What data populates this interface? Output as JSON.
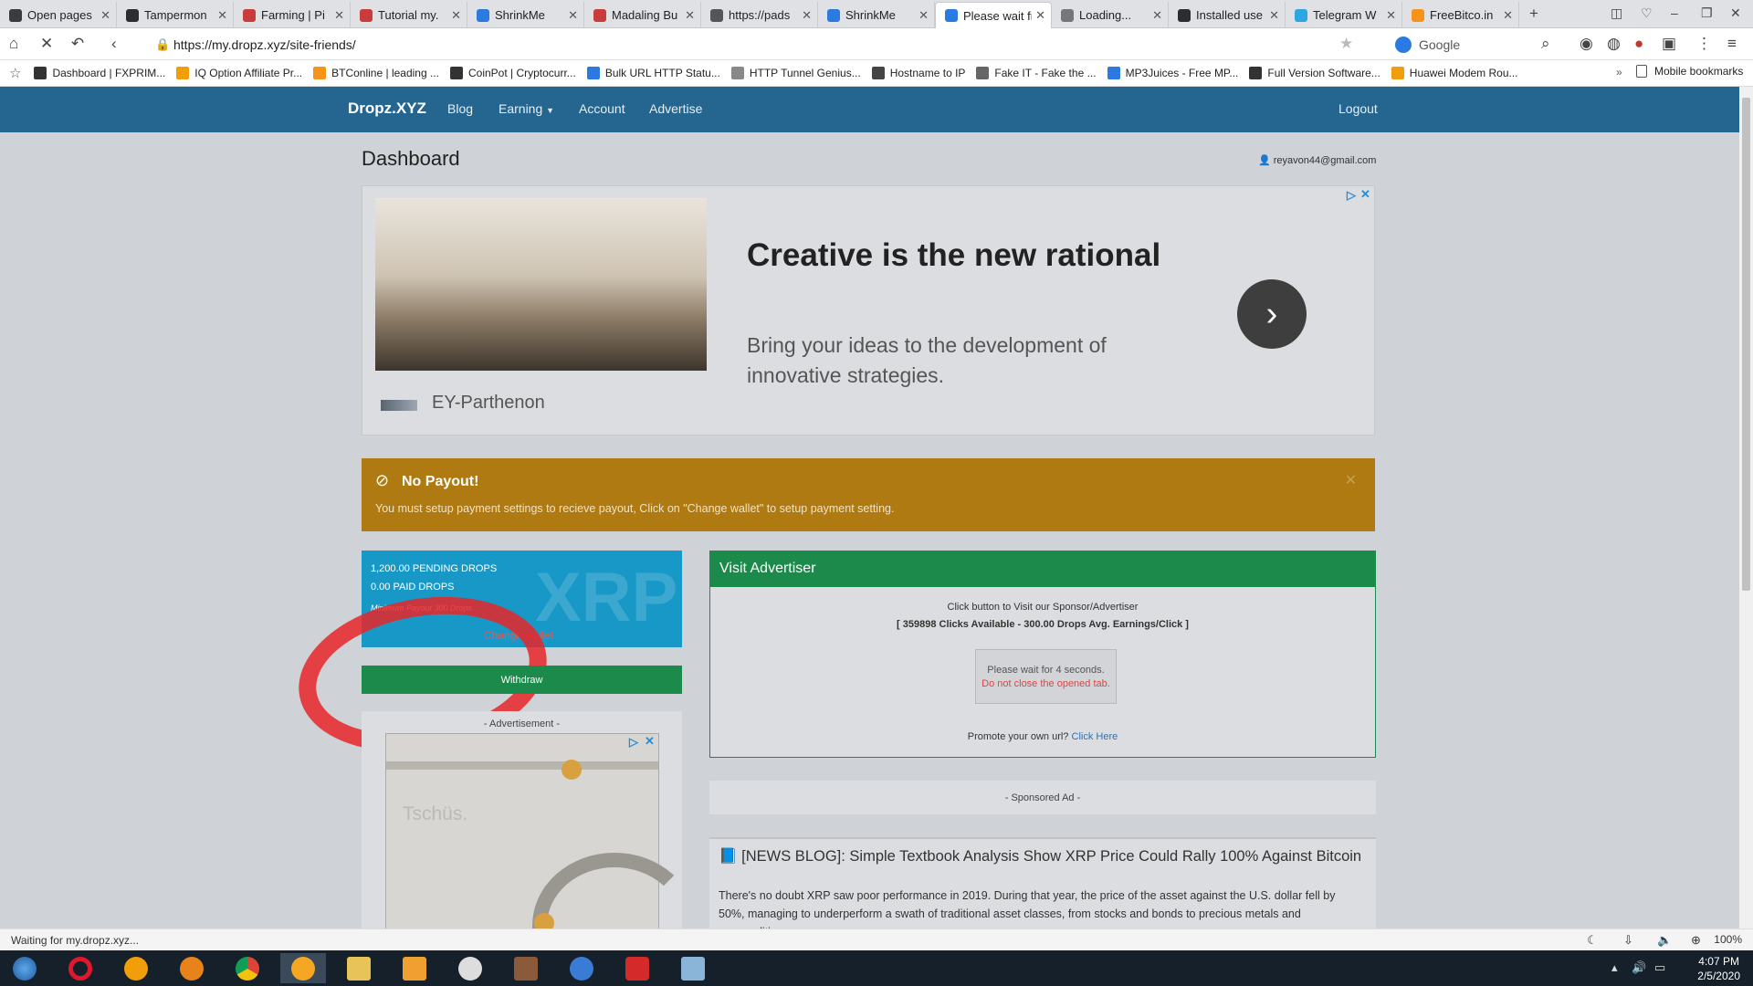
{
  "tabs": [
    {
      "label": "Open pages",
      "icon": "page-icon",
      "color": "#3b3b3b"
    },
    {
      "label": "Tampermon",
      "icon": "tampermonkey-icon",
      "color": "#2d2d2d"
    },
    {
      "label": "Farming | Pi",
      "icon": "shield-icon",
      "color": "#c83c3c"
    },
    {
      "label": "Tutorial my.",
      "icon": "shield-icon",
      "color": "#c83c3c"
    },
    {
      "label": "ShrinkMe",
      "icon": "loading-icon",
      "color": "#2a7ae2"
    },
    {
      "label": "Madaling Bu",
      "icon": "shield-icon",
      "color": "#c83c3c"
    },
    {
      "label": "https://pads",
      "icon": "page-icon",
      "color": "#555555"
    },
    {
      "label": "ShrinkMe",
      "icon": "loading-icon",
      "color": "#2a7ae2"
    },
    {
      "label": "Please wait fr",
      "icon": "loading-icon",
      "color": "#2a7ae2"
    },
    {
      "label": "Loading...",
      "icon": "loading-icon",
      "color": "#777777"
    },
    {
      "label": "Installed use",
      "icon": "tampermonkey-icon",
      "color": "#2d2d2d"
    },
    {
      "label": "Telegram W",
      "icon": "telegram-icon",
      "color": "#2ca5e0"
    },
    {
      "label": "FreeBitco.in",
      "icon": "bitcoin-icon",
      "color": "#f7931a"
    }
  ],
  "address": {
    "url": "https://my.dropz.xyz/site-friends/",
    "search_engine": "Google"
  },
  "bookmarks": [
    {
      "label": "Dashboard | FXPRIM...",
      "color": "#333333"
    },
    {
      "label": "IQ Option Affiliate Pr...",
      "color": "#f29d0a"
    },
    {
      "label": "BTConline | leading ...",
      "color": "#f7931a"
    },
    {
      "label": "CoinPot | Cryptocurr...",
      "color": "#333333"
    },
    {
      "label": "Bulk URL HTTP Statu...",
      "color": "#2a7ae2"
    },
    {
      "label": "HTTP Tunnel Genius...",
      "color": "#888888"
    },
    {
      "label": "Hostname to IP",
      "color": "#444444"
    },
    {
      "label": "Fake IT - Fake the ...",
      "color": "#666666"
    },
    {
      "label": "MP3Juices - Free MP...",
      "color": "#2a7ae2"
    },
    {
      "label": "Full Version Software...",
      "color": "#333333"
    },
    {
      "label": "Huawei Modem Rou...",
      "color": "#f29d0a"
    }
  ],
  "bookmarks_overflow": "Mobile bookmarks",
  "site": {
    "brand": "Dropz.XYZ",
    "nav": [
      "Blog",
      "Earning",
      "Account",
      "Advertise"
    ],
    "logout": "Logout",
    "page_title": "Dashboard",
    "user_email": "reyavon44@gmail.com"
  },
  "ad_top": {
    "headline": "Creative is the new rational",
    "body": "Bring your ideas to the development of innovative strategies.",
    "brand": "EY-Parthenon"
  },
  "alert": {
    "title": "No Payout!",
    "message": "You must setup payment settings to recieve payout, Click on \"Change wallet\" to setup payment setting.",
    "color": "#b07a12"
  },
  "wallet": {
    "pending": "1,200.00 PENDING DROPS",
    "paid": "0.00 PAID DROPS",
    "minimum": "Minimum Payout 300 Drops",
    "change_wallet": "Change wallet",
    "watermark": "XRP",
    "withdraw": "Withdraw"
  },
  "ad_side": {
    "label": "- Advertisement -",
    "text": "Tschüs."
  },
  "visit": {
    "title": "Visit Advertiser",
    "subtitle": "Click button to Visit our Sponsor/Advertiser",
    "stats": "[ 359898 Clicks Available - 300.00 Drops Avg. Earnings/Click ]",
    "wait": "Please wait for 4 seconds.",
    "warning": "Do not close the opened tab.",
    "promote": "Promote your own url?",
    "promote_link": "Click Here"
  },
  "sponsored": "- Sponsored Ad -",
  "news": {
    "title": "[NEWS BLOG]: Simple Textbook Analysis Show XRP Price Could Rally 100% Against Bitcoin",
    "body": "There's no doubt XRP saw poor performance in 2019. During that year, the price of the asset against the U.S. dollar fell by 50%, managing to underperform a swath of traditional asset classes, from stocks and bonds to precious metals and commodities."
  },
  "status": {
    "text": "Waiting for my.dropz.xyz...",
    "zoom": "100%"
  },
  "clock": {
    "time": "4:07 PM",
    "date": "2/5/2020"
  }
}
